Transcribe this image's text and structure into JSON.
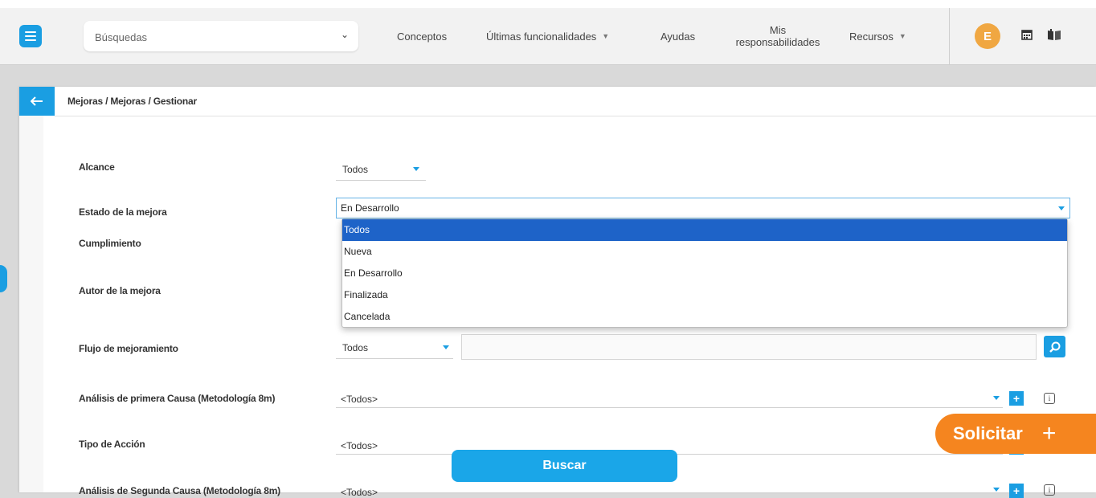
{
  "header": {
    "search_placeholder": "Búsquedas",
    "nav": [
      {
        "label": "Conceptos"
      },
      {
        "label": "Últimas funcionalidades"
      },
      {
        "label": "Ayudas"
      },
      {
        "label_line1": "Mis",
        "label_line2": "responsabilidades"
      },
      {
        "label": "Recursos"
      }
    ],
    "avatar_initial": "E",
    "icons": [
      "menu-icon",
      "calendar-icon",
      "book-icon"
    ]
  },
  "breadcrumb": "Mejoras / Mejoras / Gestionar",
  "form": {
    "alcance": {
      "label": "Alcance",
      "value": "Todos"
    },
    "estado": {
      "label": "Estado de la mejora",
      "value": "En Desarrollo",
      "options": [
        "Todos",
        "Nueva",
        "En Desarrollo",
        "Finalizada",
        "Cancelada"
      ],
      "highlighted": "Todos"
    },
    "cumplimiento": {
      "label": "Cumplimiento"
    },
    "autor": {
      "label": "Autor de la mejora"
    },
    "flujo": {
      "label": "Flujo de mejoramiento",
      "value": "Todos"
    },
    "analisis1": {
      "label": "Análisis de primera Causa (Metodología 8m)",
      "value": "<Todos>"
    },
    "tipo_accion": {
      "label": "Tipo de Acción",
      "value": "<Todos>"
    },
    "analisis2": {
      "label": "Análisis de Segunda Causa (Metodología 8m)",
      "value": "<Todos>"
    }
  },
  "buttons": {
    "buscar": "Buscar",
    "solicitar": "Solicitar",
    "solicitar_plus": "+"
  },
  "colors": {
    "accent": "#1a9ee2",
    "selected_option": "#1e63c8",
    "solicitar": "#f5851f",
    "avatar": "#f0a742"
  }
}
